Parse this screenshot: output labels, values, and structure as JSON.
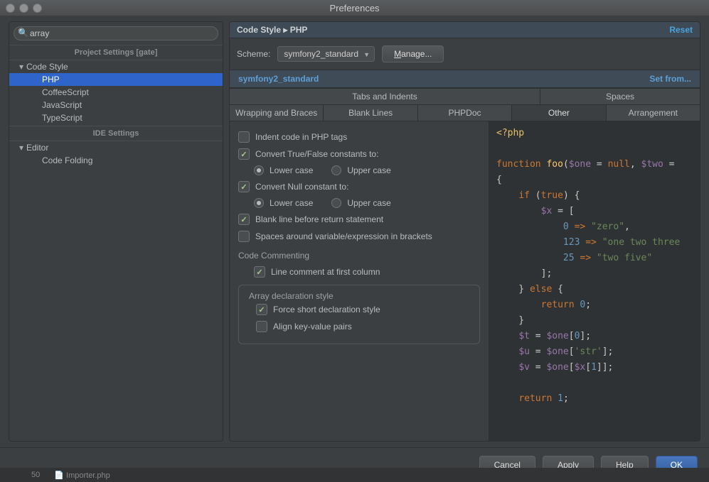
{
  "window": {
    "title": "Preferences"
  },
  "search": {
    "value": "array",
    "placeholder": ""
  },
  "sidebar": {
    "section1": "Project Settings [gate]",
    "section2": "IDE Settings",
    "codeStyle": "Code Style",
    "items1": [
      "PHP",
      "CoffeeScript",
      "JavaScript",
      "TypeScript"
    ],
    "editor": "Editor",
    "items2": [
      "Code Folding"
    ]
  },
  "breadcrumb": {
    "a": "Code Style",
    "b": "PHP",
    "reset": "Reset"
  },
  "scheme": {
    "label": "Scheme:",
    "value": "symfony2_standard",
    "manage": "Manage...",
    "manage_mn": "M"
  },
  "schemeTitle": {
    "name": "symfony2_standard",
    "setfrom": "Set from..."
  },
  "tabsTop": [
    "Tabs and Indents",
    "Spaces"
  ],
  "tabsBottom": [
    "Wrapping and Braces",
    "Blank Lines",
    "PHPDoc",
    "Other",
    "Arrangement"
  ],
  "opts": {
    "indent": "Indent code in PHP tags",
    "convTF": "Convert True/False constants to:",
    "lower": "Lower case",
    "upper": "Upper case",
    "convNull": "Convert Null constant to:",
    "blankReturn": "Blank line before return statement",
    "spacesBrackets": "Spaces around variable/expression in brackets",
    "codeCommenting": "Code Commenting",
    "lineComment": "Line comment at first column",
    "arrayLegend": "Array declaration style",
    "forceShort": "Force short declaration style",
    "alignKV": "Align key-value pairs"
  },
  "footer": {
    "cancel": "Cancel",
    "apply": "Apply",
    "help": "Help",
    "ok": "OK"
  },
  "backdrop": {
    "a": "50",
    "b": "Importer.php"
  }
}
